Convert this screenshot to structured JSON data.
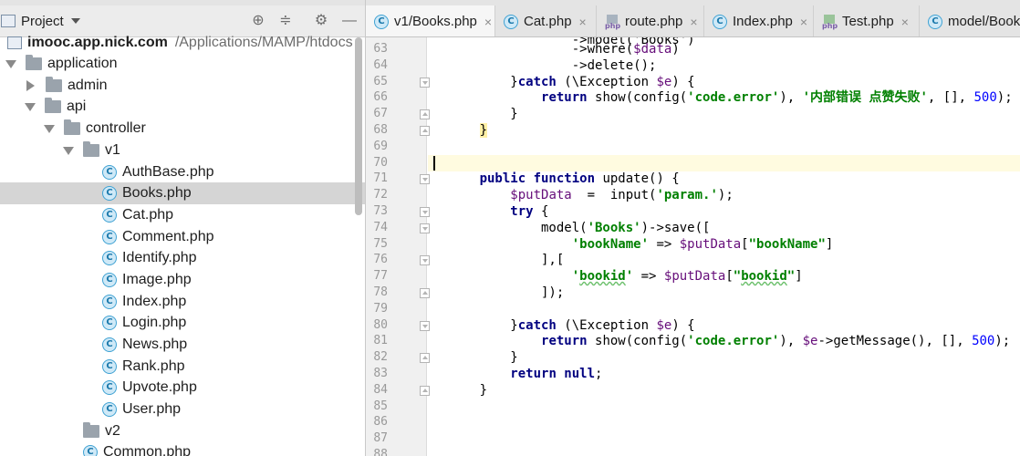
{
  "panel": {
    "title": "Project",
    "icons": [
      "crosshair-icon",
      "collapse-icon",
      "gear-icon",
      "minimize-icon"
    ]
  },
  "tree": [
    {
      "label": "imooc.app.nick.com",
      "path": "/Applications/MAMP/htdocs",
      "kind": "module",
      "expanded": true
    },
    {
      "label": "application",
      "kind": "folder",
      "expanded": true
    },
    {
      "label": "admin",
      "kind": "folder",
      "expanded": false
    },
    {
      "label": "api",
      "kind": "folder",
      "expanded": true
    },
    {
      "label": "controller",
      "kind": "folder",
      "expanded": true
    },
    {
      "label": "v1",
      "kind": "folder",
      "expanded": true
    },
    {
      "label": "AuthBase.php",
      "kind": "class"
    },
    {
      "label": "Books.php",
      "kind": "class",
      "selected": true
    },
    {
      "label": "Cat.php",
      "kind": "class"
    },
    {
      "label": "Comment.php",
      "kind": "class"
    },
    {
      "label": "Identify.php",
      "kind": "class"
    },
    {
      "label": "Image.php",
      "kind": "class"
    },
    {
      "label": "Index.php",
      "kind": "class"
    },
    {
      "label": "Login.php",
      "kind": "class"
    },
    {
      "label": "News.php",
      "kind": "class"
    },
    {
      "label": "Rank.php",
      "kind": "class"
    },
    {
      "label": "Upvote.php",
      "kind": "class"
    },
    {
      "label": "User.php",
      "kind": "class"
    },
    {
      "label": "v2",
      "kind": "folder"
    },
    {
      "label": "Common.php",
      "kind": "class"
    }
  ],
  "tabs": [
    {
      "label": "v1/Books.php",
      "icon": "class-icon",
      "active": true
    },
    {
      "label": "Cat.php",
      "icon": "class-icon"
    },
    {
      "label": "route.php",
      "icon": "php-file-icon"
    },
    {
      "label": "Index.php",
      "icon": "class-icon"
    },
    {
      "label": "Test.php",
      "icon": "php-test-icon"
    },
    {
      "label": "model/Books",
      "icon": "class-icon"
    }
  ],
  "colors": {
    "selection": "#d5d5d5",
    "current_line": "#fffbe0",
    "keyword": "#000080",
    "string": "#008000",
    "number": "#0000ff",
    "variable": "#660e7a"
  },
  "code": {
    "line_numbers": [
      "63",
      "64",
      "65",
      "66",
      "67",
      "68",
      "69",
      "70",
      "71",
      "72",
      "73",
      "74",
      "75",
      "76",
      "77",
      "78",
      "79",
      "80",
      "81",
      "82",
      "83",
      "84",
      "85",
      "86",
      "87",
      "88"
    ],
    "current_line": "70"
  }
}
